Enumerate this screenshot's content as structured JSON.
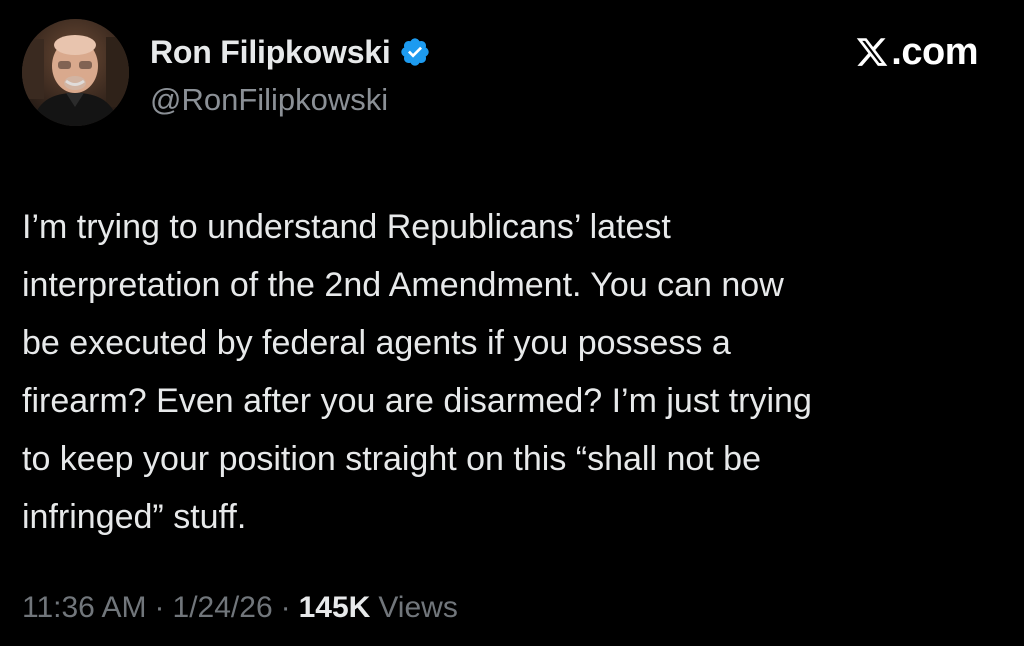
{
  "author": {
    "display_name": "Ron Filipkowski",
    "handle": "@RonFilipkowski",
    "verified": true,
    "avatar": "profile-photo"
  },
  "site": {
    "logo_icon": "x-logo-icon",
    "label": ".com"
  },
  "tweet": {
    "lines": [
      "I’m trying to understand Republicans’ latest",
      "interpretation of the 2nd Amendment. You can now",
      "be executed by federal agents if you possess a",
      "firearm? Even after you are disarmed? I’m just trying",
      "to keep your position straight on this “shall not be",
      "infringed” stuff."
    ]
  },
  "meta": {
    "time": "11:36 AM",
    "separator": "·",
    "date": "1/24/26",
    "views_count": "145K",
    "views_label": "Views"
  },
  "colors": {
    "background": "#000000",
    "primary_text": "#e7e9ea",
    "secondary_text": "#71767b",
    "verified_badge": "#1d9bf0"
  }
}
